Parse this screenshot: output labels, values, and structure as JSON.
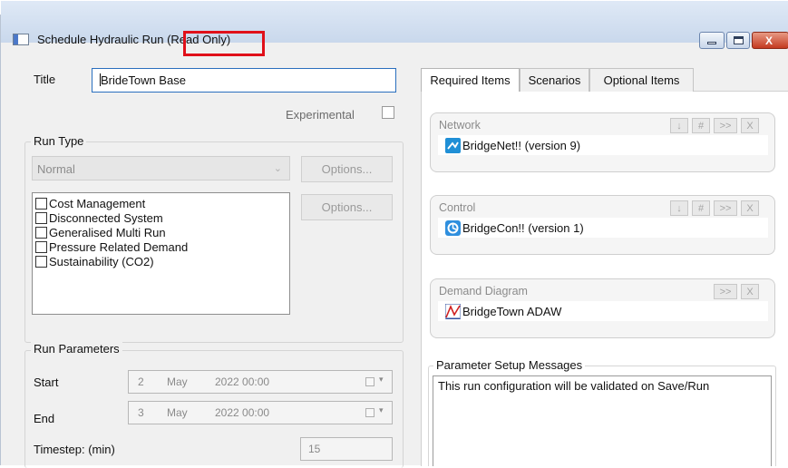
{
  "window": {
    "title": "Schedule Hydraulic Run",
    "title_suffix": "(Read Only)",
    "close_glyph": "X",
    "highlight_color": "#e0101a"
  },
  "form": {
    "title_label": "Title",
    "title_value": "BrideTown Base",
    "experimental_label": "Experimental",
    "run_type": {
      "group_label": "Run Type",
      "selected": "Normal",
      "options_label": "Options...",
      "options_label_2": "Options...",
      "items": [
        "Cost Management",
        "Disconnected System",
        "Generalised Multi Run",
        "Pressure Related Demand",
        "Sustainability (CO2)"
      ]
    },
    "run_parameters": {
      "group_label": "Run Parameters",
      "start_label": "Start",
      "start": {
        "day": "2",
        "month": "May",
        "year_time": "2022  00:00"
      },
      "end_label": "End",
      "end": {
        "day": "3",
        "month": "May",
        "year_time": "2022  00:00"
      },
      "timestep_label": "Timestep: (min)",
      "timestep_value": "15"
    }
  },
  "tabs": [
    {
      "label": "Required Items",
      "active": true
    },
    {
      "label": "Scenarios",
      "active": false
    },
    {
      "label": "Optional Items",
      "active": false
    }
  ],
  "required_items": {
    "network": {
      "header": "Network",
      "value": "BridgeNet!! (version 9)",
      "buttons": [
        "↓",
        "#",
        ">>",
        "X"
      ]
    },
    "control": {
      "header": "Control",
      "value": "BridgeCon!! (version 1)",
      "buttons": [
        "↓",
        "#",
        ">>",
        "X"
      ]
    },
    "demand": {
      "header": "Demand Diagram",
      "value": "BridgeTown ADAW",
      "buttons": [
        ">>",
        "X"
      ]
    }
  },
  "messages": {
    "group_label": "Parameter Setup Messages",
    "text": "This run configuration will be validated on Save/Run"
  }
}
